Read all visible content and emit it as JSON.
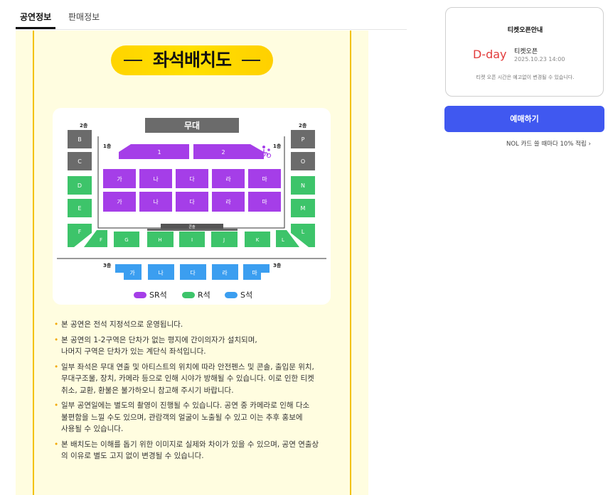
{
  "tabs": [
    {
      "label": "공연정보",
      "active": true
    },
    {
      "label": "판매정보",
      "active": false
    }
  ],
  "poster": {
    "title": "좌석배치도",
    "stage_label": "무대",
    "console_label": "콘솔",
    "floor1_labels": [
      "1층",
      "1층"
    ],
    "floor2_labels": [
      "2층",
      "2층"
    ],
    "floor3_labels": [
      "3층",
      "3층"
    ],
    "wheelchair_icon": "wheelchair-icon",
    "floor1_sr_top": [
      "1",
      "2"
    ],
    "floor1_grid_row1": [
      "가",
      "나",
      "다",
      "라",
      "마"
    ],
    "floor1_grid_row2": [
      "가",
      "나",
      "다",
      "라",
      "마"
    ],
    "left_sections": [
      "B",
      "C",
      "D",
      "E",
      "F"
    ],
    "right_sections": [
      "P",
      "O",
      "N",
      "M",
      "L"
    ],
    "bottom_sections": [
      "F",
      "G",
      "H",
      "I",
      "J",
      "K",
      "L"
    ],
    "floor3_sections": [
      "가",
      "나",
      "다",
      "라",
      "마"
    ],
    "legend": [
      {
        "label": "SR석",
        "color": "#a53ee8"
      },
      {
        "label": "R석",
        "color": "#3dc46a"
      },
      {
        "label": "S석",
        "color": "#3b9ef0"
      }
    ],
    "colors": {
      "sr": "#a53ee8",
      "r": "#3dc46a",
      "s": "#3b9ef0",
      "gray": "#6b6b6b",
      "rail": "#f2c200"
    },
    "notes": [
      "본 공연은 전석 지정석으로 운영됩니다.",
      "본 공연의 1-2구역은 단차가 없는 평지에 간이의자가 설치되며,\n나머지 구역은 단차가 있는 계단식 좌석입니다.",
      "일부 좌석은 무대 연출 및 아티스트의 위치에 따라 안전펜스 및 콘솔, 출입문 위치,\n무대구조물, 장치, 카메라 등으로 인해 시야가 방해될 수 있습니다. 이로 인한 티켓\n취소, 교환, 환불은 불가하오니 참고해 주시기 바랍니다.",
      "일부 공연일에는 별도의 촬영이 진행될 수 있습니다. 공연 중 카메라로 인해 다소\n불편함을 느낄 수도 있으며, 관람객의 얼굴이 노출될 수 있고 이는 추후 홍보에\n사용될 수 있습니다.",
      "본 배치도는 이해를 돕기 위한 이미지로 실제와 차이가 있을 수 있으며, 공연 연출상\n의 이유로 별도 고지 없이 변경될 수 있습니다."
    ]
  },
  "sidebar": {
    "card_title": "티켓오픈안내",
    "dday": "D-day",
    "open_label": "티켓오픈",
    "open_datetime": "2025.10.23 14:00",
    "notice": "티켓 오픈 시간은 예고없이 변경될 수 있습니다.",
    "book_button": "예매하기",
    "promo": "NOL 카드 쓸 때마다 10% 적립 ›"
  }
}
